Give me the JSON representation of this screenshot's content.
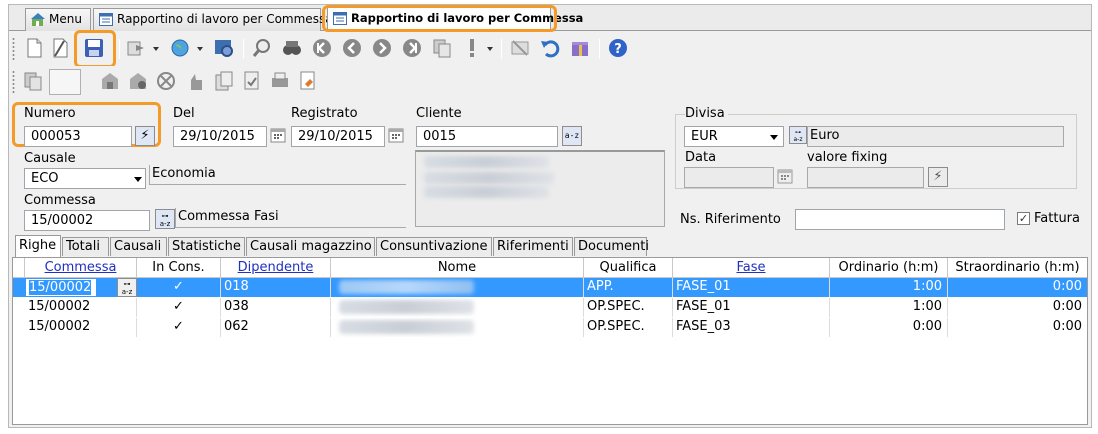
{
  "tabs": [
    {
      "label": "Menu"
    },
    {
      "label": "Rapportino di lavoro per Commessa"
    },
    {
      "label": "Rapportino di lavoro per Commessa"
    }
  ],
  "icons": {
    "toolbar1": [
      "new-document-icon",
      "edit-document-icon",
      "save-icon",
      "export-icon",
      "globe-icon",
      "settings-icon",
      "search-icon",
      "binoculars-icon",
      "first-record-icon",
      "previous-record-icon",
      "next-record-icon",
      "last-record-icon",
      "copy-icon",
      "alert-icon",
      "delete-icon",
      "undo-icon",
      "gift-icon",
      "help-icon"
    ],
    "toolbar2": [
      "copy-record-icon",
      "blank-icon",
      "cart-icon",
      "cart-settings-icon",
      "tools-icon",
      "hand-icon",
      "documents-icon",
      "document-check-icon",
      "print-icon",
      "report-icon"
    ]
  },
  "form": {
    "numero_label": "Numero",
    "numero_value": "000053",
    "del_label": "Del",
    "del_value": "29/10/2015",
    "registrato_label": "Registrato",
    "registrato_value": "29/10/2015",
    "cliente_label": "Cliente",
    "cliente_value": "0015",
    "divisa_label": "Divisa",
    "divisa_value": "EUR",
    "divisa_desc": "Euro",
    "data_label": "Data",
    "data_value": "",
    "fixing_label": "valore fixing",
    "fixing_value": "",
    "causale_label": "Causale",
    "causale_value": "ECO",
    "causale_desc": "Economia",
    "commessa_label": "Commessa",
    "commessa_value": "15/00002",
    "commessa_desc": "Commessa Fasi",
    "ns_rif_label": "Ns. Riferimento",
    "ns_rif_value": "",
    "fattura_label": "Fattura",
    "fattura_checked": true,
    "lookup_icon": "a-z",
    "lightning_icon": "⚡"
  },
  "grid_tabs": [
    "Righe",
    "Totali",
    "Causali",
    "Statistiche",
    "Causali magazzino",
    "Consuntivazione",
    "Riferimenti",
    "Documenti"
  ],
  "grid": {
    "columns": [
      "Commessa",
      "In Cons.",
      "Dipendente",
      "Nome",
      "Qualifica",
      "Fase",
      "Ordinario (h:m)",
      "Straordinario (h:m)"
    ],
    "rows": [
      {
        "commessa": "15/00002",
        "in_cons": "✓",
        "dipendente": "018",
        "nome": "",
        "qualifica": "APP.",
        "fase": "FASE_01",
        "ordinario": "1:00",
        "straordinario": "0:00"
      },
      {
        "commessa": "15/00002",
        "in_cons": "✓",
        "dipendente": "038",
        "nome": "",
        "qualifica": "OP.SPEC.",
        "fase": "FASE_01",
        "ordinario": "1:00",
        "straordinario": "0:00"
      },
      {
        "commessa": "15/00002",
        "in_cons": "✓",
        "dipendente": "062",
        "nome": "",
        "qualifica": "OP.SPEC.",
        "fase": "FASE_03",
        "ordinario": "0:00",
        "straordinario": "0:00"
      }
    ]
  },
  "colors": {
    "accent": "#f39a28",
    "selection": "#3399ff",
    "link": "#2030c0"
  }
}
